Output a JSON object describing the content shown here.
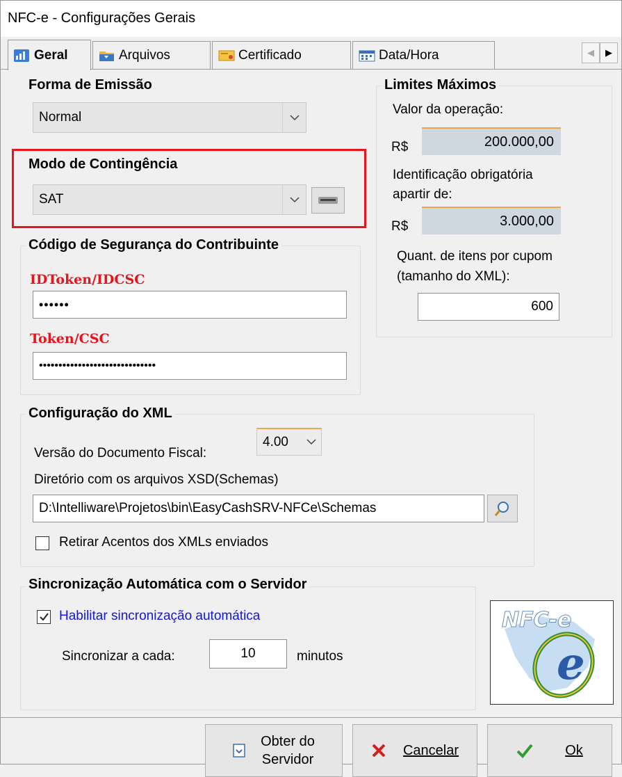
{
  "window": {
    "title": "NFC-e - Configurações Gerais"
  },
  "tabs": [
    {
      "label": "Geral",
      "icon": "chart-icon"
    },
    {
      "label": "Arquivos",
      "icon": "folder-icon"
    },
    {
      "label": "Certificado",
      "icon": "certificate-icon"
    },
    {
      "label": "Data/Hora",
      "icon": "calendar-icon"
    }
  ],
  "forma_emissao": {
    "label": "Forma de Emissão",
    "value": "Normal"
  },
  "modo_contingencia": {
    "label": "Modo de Contingência",
    "value": "SAT"
  },
  "csc": {
    "label": "Código de Segurança do Contribuinte",
    "idtoken_label": "IDToken/IDCSC",
    "idtoken_value": "••••••",
    "token_label": "Token/CSC",
    "token_value": "••••••••••••••••••••••••••••••"
  },
  "limites": {
    "label": "Limites Máximos",
    "valor_label": "Valor da operação:",
    "currency": "R$",
    "valor_value": "200.000,00",
    "ident_label_1": "Identificação obrigatória",
    "ident_label_2": "apartir de:",
    "ident_value": "3.000,00",
    "itens_label_1": "Quant. de itens por cupom",
    "itens_label_2": "(tamanho do XML):",
    "itens_value": "600"
  },
  "xml": {
    "label": "Configuração do XML",
    "versao_label": "Versão do Documento Fiscal:",
    "versao_value": "4.00",
    "dir_label": "Diretório com os arquivos XSD(Schemas)",
    "dir_value": "D:\\Intelliware\\Projetos\\bin\\EasyCashSRV-NFCe\\Schemas",
    "acentos_label": "Retirar Acentos dos XMLs enviados",
    "acentos_checked": false
  },
  "sync": {
    "label": "Sincronização Automática com o Servidor",
    "enable_label": "Habilitar sincronização automática",
    "enable_checked": true,
    "interval_label": "Sincronizar a cada:",
    "interval_value": "10",
    "interval_unit": "minutos"
  },
  "logo": {
    "text": "NFC-e"
  },
  "buttons": {
    "obter_line1": "Obter do",
    "obter_line2": "Servidor",
    "cancelar": "Cancelar",
    "ok": "Ok"
  },
  "colors": {
    "highlight": "#e8141c",
    "link": "#1414e6",
    "readonly_bg": "#cfd8e1"
  }
}
